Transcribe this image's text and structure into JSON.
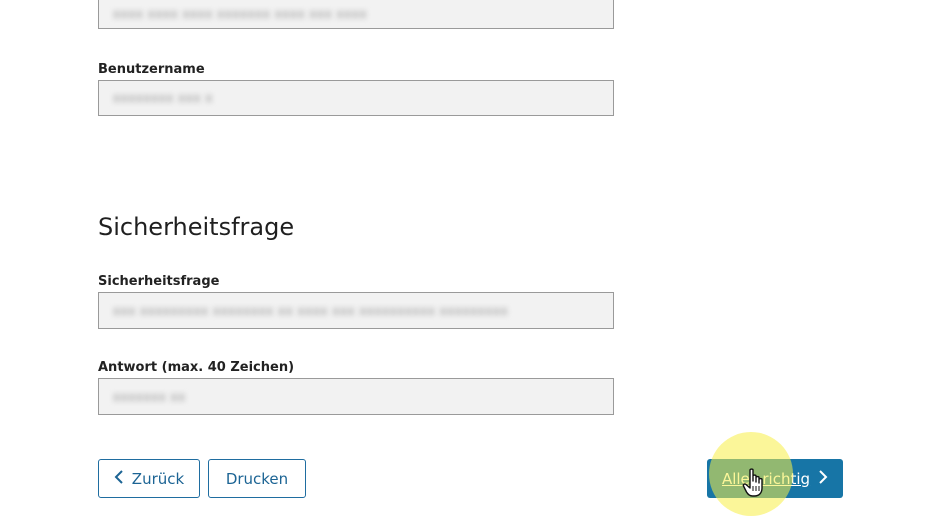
{
  "top_field": {
    "value": "xxxx xxxx xxxx xxxxxxx xxxx xxx xxxx"
  },
  "username": {
    "label": "Benutzername",
    "value": "xxxxxxxx xxx x"
  },
  "security": {
    "section_title": "Sicherheitsfrage",
    "question": {
      "label": "Sicherheitsfrage",
      "value": "xxx xxxxxxxxx xxxxxxxx xx xxxx xxx xxxxxxxxxx xxxxxxxxx"
    },
    "answer": {
      "label": "Antwort (max. 40 Zeichen)",
      "value": "xxxxxxx xx"
    }
  },
  "actions": {
    "back_label": "Zurück",
    "print_label": "Drucken",
    "confirm_label": "Alles richtig"
  },
  "icons": {
    "back": "chevron-left-icon",
    "next": "chevron-right-icon",
    "cursor": "hand-pointer-icon"
  },
  "colors": {
    "primary": "#1775a6",
    "outline_button_border": "#1f6da0",
    "field_background": "#f2f2f2",
    "click_highlight": "#f7ee46"
  }
}
